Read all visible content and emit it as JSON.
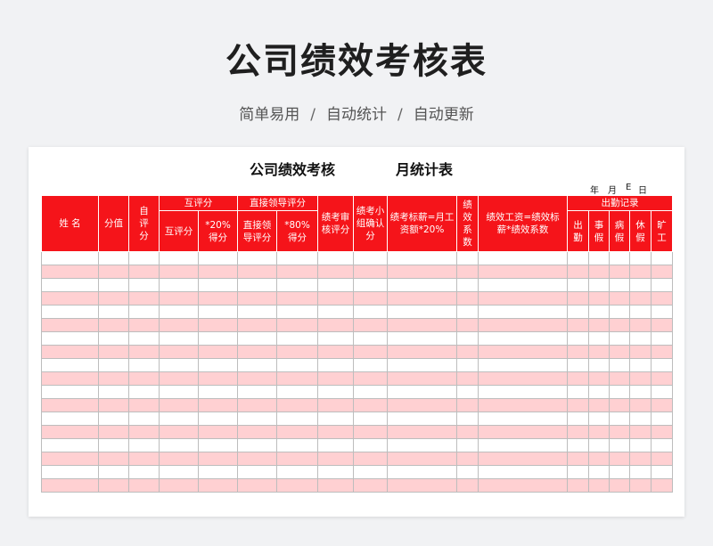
{
  "page": {
    "title": "公司绩效考核表",
    "subtitle": [
      "简单易用",
      "自动统计",
      "自动更新"
    ],
    "separator": "/"
  },
  "sheet": {
    "title_part1": "公司绩效考核",
    "title_part2": "月统计表",
    "date": {
      "year": "年",
      "month": "月",
      "day": "日",
      "mark": "E"
    },
    "header": {
      "name": "姓  名",
      "score": "分值",
      "self_eval": "自评分",
      "mutual_group": "互评分",
      "mutual_score": "互评分",
      "mutual_weighted": "*20%得分",
      "leader_group": "直接领导评分",
      "leader_score": "直接领导评分",
      "leader_weighted": "*80%得分",
      "review_score": "绩考审核评分",
      "group_confirm": "绩考小组确认分",
      "salary_formula": "绩考标薪=月工资额*20%",
      "coefficient": "绩效系数",
      "pay_formula": "绩效工资=绩效标薪*绩效系数",
      "attendance_group": "出勤记录",
      "attendance": [
        "出勤",
        "事假",
        "病假",
        "休假",
        "旷工"
      ]
    },
    "row_count": 18
  },
  "colors": {
    "header_red": "#f5141a",
    "stripe_pink": "#ffd0d2"
  }
}
